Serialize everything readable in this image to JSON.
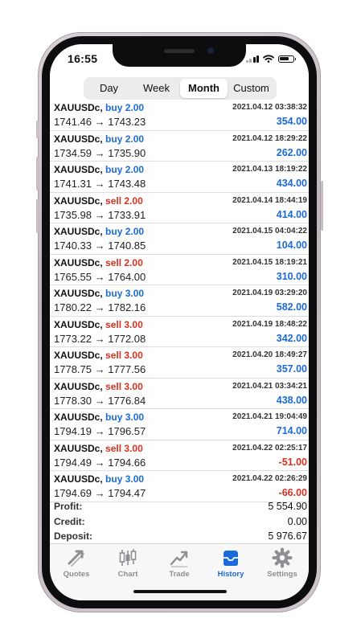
{
  "status": {
    "time": "16:55"
  },
  "periods": [
    "Day",
    "Week",
    "Month",
    "Custom"
  ],
  "active_period": "Month",
  "trades": [
    {
      "symbol": "XAUUSDc,",
      "action": "buy",
      "lot": "buy 2.00",
      "open_price": "1741.46",
      "arrow": "→",
      "close_price": "1743.23",
      "datetime": "2021.04.12 03:38:32",
      "profit": "354.00"
    },
    {
      "symbol": "XAUUSDc,",
      "action": "buy",
      "lot": "buy 2.00",
      "open_price": "1734.59",
      "arrow": "→",
      "close_price": "1735.90",
      "datetime": "2021.04.12 18:29:22",
      "profit": "262.00"
    },
    {
      "symbol": "XAUUSDc,",
      "action": "buy",
      "lot": "buy 2.00",
      "open_price": "1741.31",
      "arrow": "→",
      "close_price": "1743.48",
      "datetime": "2021.04.13 18:19:22",
      "profit": "434.00"
    },
    {
      "symbol": "XAUUSDc,",
      "action": "sell",
      "lot": "sell 2.00",
      "open_price": "1735.98",
      "arrow": "→",
      "close_price": "1733.91",
      "datetime": "2021.04.14 18:44:19",
      "profit": "414.00"
    },
    {
      "symbol": "XAUUSDc,",
      "action": "buy",
      "lot": "buy 2.00",
      "open_price": "1740.33",
      "arrow": "→",
      "close_price": "1740.85",
      "datetime": "2021.04.15 04:04:22",
      "profit": "104.00"
    },
    {
      "symbol": "XAUUSDc,",
      "action": "sell",
      "lot": "sell 2.00",
      "open_price": "1765.55",
      "arrow": "→",
      "close_price": "1764.00",
      "datetime": "2021.04.15 18:19:21",
      "profit": "310.00"
    },
    {
      "symbol": "XAUUSDc,",
      "action": "buy",
      "lot": "buy 3.00",
      "open_price": "1780.22",
      "arrow": "→",
      "close_price": "1782.16",
      "datetime": "2021.04.19 03:29:20",
      "profit": "582.00"
    },
    {
      "symbol": "XAUUSDc,",
      "action": "sell",
      "lot": "sell 3.00",
      "open_price": "1773.22",
      "arrow": "→",
      "close_price": "1772.08",
      "datetime": "2021.04.19 18:48:22",
      "profit": "342.00"
    },
    {
      "symbol": "XAUUSDc,",
      "action": "sell",
      "lot": "sell 3.00",
      "open_price": "1778.75",
      "arrow": "→",
      "close_price": "1777.56",
      "datetime": "2021.04.20 18:49:27",
      "profit": "357.00"
    },
    {
      "symbol": "XAUUSDc,",
      "action": "sell",
      "lot": "sell 3.00",
      "open_price": "1778.30",
      "arrow": "→",
      "close_price": "1776.84",
      "datetime": "2021.04.21 03:34:21",
      "profit": "438.00"
    },
    {
      "symbol": "XAUUSDc,",
      "action": "buy",
      "lot": "buy 3.00",
      "open_price": "1794.19",
      "arrow": "→",
      "close_price": "1796.57",
      "datetime": "2021.04.21 19:04:49",
      "profit": "714.00"
    },
    {
      "symbol": "XAUUSDc,",
      "action": "sell",
      "lot": "sell 3.00",
      "open_price": "1794.49",
      "arrow": "→",
      "close_price": "1794.66",
      "datetime": "2021.04.22 02:25:17",
      "profit": "-51.00"
    },
    {
      "symbol": "XAUUSDc,",
      "action": "buy",
      "lot": "buy 3.00",
      "open_price": "1794.69",
      "arrow": "→",
      "close_price": "1794.47",
      "datetime": "2021.04.22 02:26:29",
      "profit": "-66.00"
    }
  ],
  "summary": {
    "profit_label": "Profit:",
    "profit_value": "5 554.90",
    "credit_label": "Credit:",
    "credit_value": "0.00",
    "deposit_label": "Deposit:",
    "deposit_value": "5 976.67"
  },
  "tabs": [
    {
      "label": "Quotes",
      "icon": "quotes-icon"
    },
    {
      "label": "Chart",
      "icon": "candles-icon"
    },
    {
      "label": "Trade",
      "icon": "trend-icon"
    },
    {
      "label": "History",
      "icon": "inbox-icon"
    },
    {
      "label": "Settings",
      "icon": "gear-icon"
    }
  ],
  "active_tab": "History",
  "colors": {
    "buy": "#1a6ad9",
    "sell": "#d8311f",
    "positive": "#1a6ad9",
    "negative": "#d8311f",
    "active_tab": "#1a6ad9",
    "inactive_tab": "#8e8e93"
  }
}
